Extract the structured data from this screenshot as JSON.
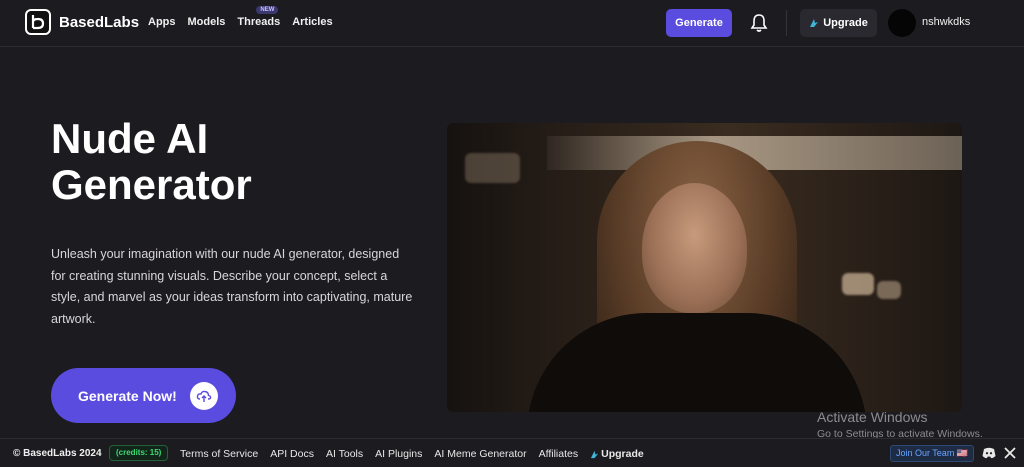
{
  "header": {
    "brand": "BasedLabs",
    "nav": [
      {
        "label": "Apps"
      },
      {
        "label": "Models"
      },
      {
        "label": "Threads",
        "badge": "NEW"
      },
      {
        "label": "Articles"
      }
    ],
    "generate_label": "Generate",
    "upgrade_label": "Upgrade",
    "username": "nshwkdks"
  },
  "hero": {
    "title": "Nude AI Generator",
    "description": "Unleash your imagination with our nude AI generator, designed for creating stunning visuals. Describe your concept, select a style, and marvel as your ideas transform into captivating, mature artwork.",
    "cta_label": "Generate Now!"
  },
  "watermark": {
    "title": "Activate Windows",
    "subtitle": "Go to Settings to activate Windows."
  },
  "footer": {
    "copyright": "© BasedLabs 2024",
    "credits": "(credits: 15)",
    "links": [
      "Terms of Service",
      "API Docs",
      "AI Tools",
      "AI Plugins",
      "AI Meme Generator",
      "Affiliates"
    ],
    "upgrade_label": "Upgrade",
    "join_team": "Join Our Team 🇺🇸"
  },
  "colors": {
    "accent": "#5b4ce0",
    "background": "#1c1b1f",
    "credits_green": "#3ddc73"
  },
  "icons": [
    "bell-icon",
    "upgrade-bolt-icon",
    "upload-cloud-icon",
    "discord-icon",
    "x-icon"
  ]
}
